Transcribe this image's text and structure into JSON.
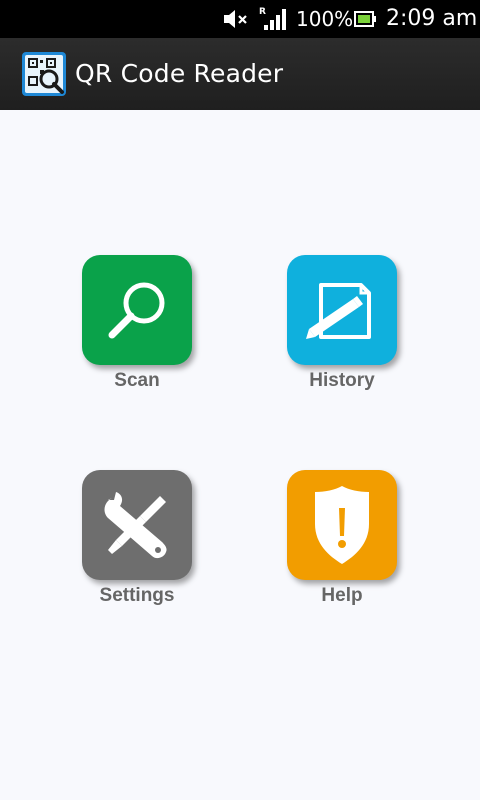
{
  "status_bar": {
    "battery_percent": "100%",
    "time": "2:09 am",
    "signal_indicator": "R",
    "icons": [
      "mute-icon",
      "signal-icon",
      "battery-icon"
    ]
  },
  "action_bar": {
    "title": "QR Code Reader",
    "icon": "qr-search-icon"
  },
  "menu": {
    "tiles": [
      {
        "label": "Scan",
        "icon": "magnifier-icon",
        "color": "#0aa24a"
      },
      {
        "label": "History",
        "icon": "note-pencil-icon",
        "color": "#0fb0dd"
      },
      {
        "label": "Settings",
        "icon": "wrench-screwdriver-icon",
        "color": "#6e6e6e"
      },
      {
        "label": "Help",
        "icon": "shield-exclamation-icon",
        "color": "#f29d00"
      }
    ]
  }
}
